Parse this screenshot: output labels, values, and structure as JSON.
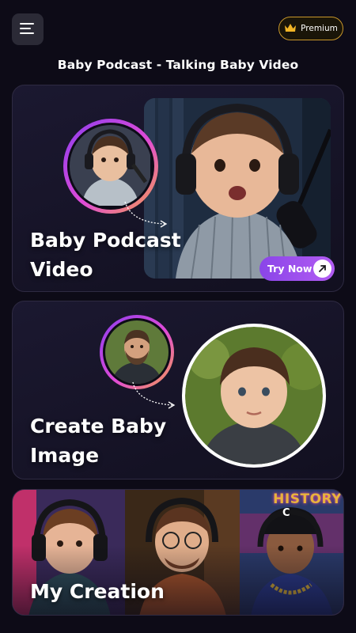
{
  "header": {
    "menu_icon": "menu-icon",
    "premium_icon": "crown-icon",
    "premium_label": "Premium",
    "title": "Baby Podcast - Talking Baby Video"
  },
  "cards": [
    {
      "title_line1": "Baby Podcast",
      "title_line2": "Video",
      "button_label": "Try Now",
      "button_icon": "arrow-up-right-icon"
    },
    {
      "title_line1": "Create Baby",
      "title_line2": "Image"
    },
    {
      "title": "My Creation",
      "panel3_sign": "HISTORY",
      "cap_letter": "C"
    }
  ],
  "colors": {
    "background": "#0d0b17",
    "accent_purple": "#8a45e8",
    "premium_gold": "#c9972a"
  }
}
